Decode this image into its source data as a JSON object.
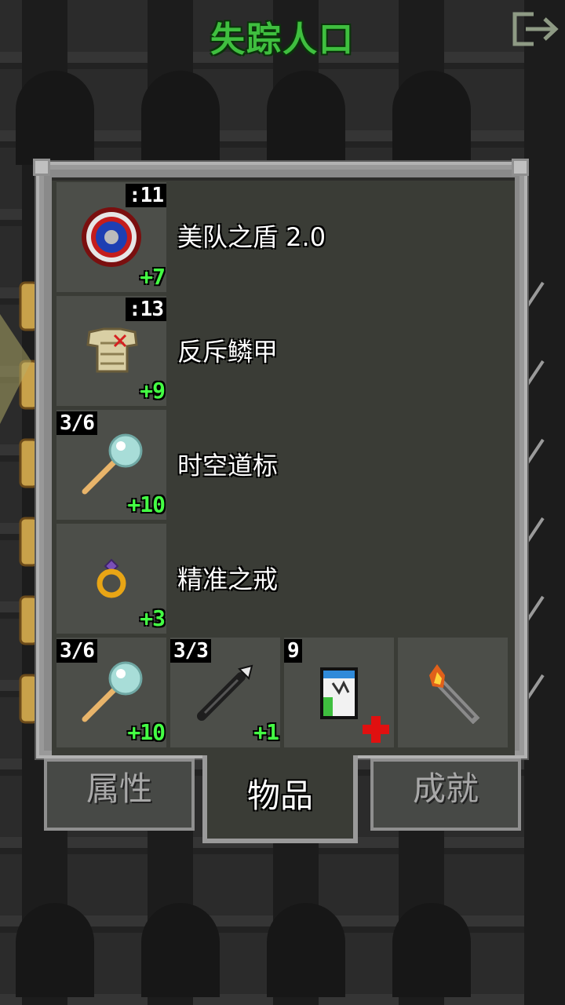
{
  "header": {
    "title": "失踪人口"
  },
  "items": [
    {
      "name": "美队之盾 2.0",
      "badge": ":11",
      "level": "+7",
      "icon": "shield-icon"
    },
    {
      "name": "反斥鳞甲",
      "badge": ":13",
      "level": "+9",
      "icon": "armor-icon"
    },
    {
      "name": "时空道标",
      "badge": "3/6",
      "level": "+10",
      "icon": "wand-icon"
    },
    {
      "name": "精准之戒",
      "badge": "",
      "level": "+3",
      "icon": "ring-icon"
    }
  ],
  "quickslots": [
    {
      "badge": "3/6",
      "level": "+10",
      "icon": "wand-icon"
    },
    {
      "badge": "3/3",
      "level": "+1",
      "icon": "dart-icon"
    },
    {
      "badge": "9",
      "level": "",
      "icon": "scroll-icon"
    },
    {
      "badge": "",
      "level": "",
      "icon": "torch-icon"
    }
  ],
  "tabs": [
    {
      "label": "属性",
      "active": false
    },
    {
      "label": "物品",
      "active": true
    },
    {
      "label": "成就",
      "active": false
    }
  ],
  "colors": {
    "title": "#3fbf3f",
    "level": "#44ff44",
    "heal_cross": "#e01010"
  }
}
